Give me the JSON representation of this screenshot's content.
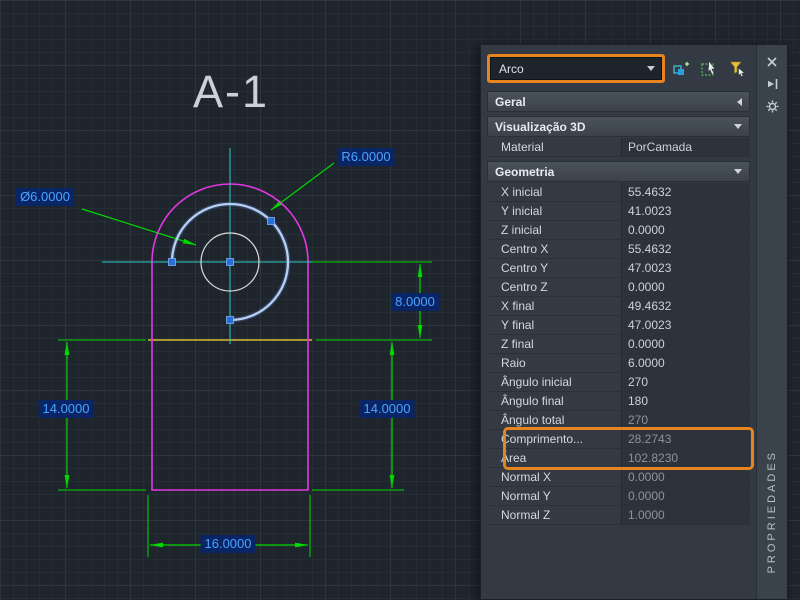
{
  "drawing": {
    "title": "A-1",
    "labels": {
      "diameter": "Ø6.0000",
      "radius": "R6.0000",
      "dim_8": "8.0000",
      "dim_14_left": "14.0000",
      "dim_14_right": "14.0000",
      "dim_16": "16.0000"
    }
  },
  "panel": {
    "object_selector": {
      "value": "Arco"
    },
    "toolbar": {
      "icons": [
        "toggle-value-icon",
        "select-objects-icon",
        "quick-select-icon"
      ]
    },
    "titlebar": {
      "icons": [
        "close-icon",
        "auto-hide-icon",
        "settings-icon"
      ],
      "title": "PROPRIEDADES"
    },
    "sections": {
      "geral": {
        "label": "Geral",
        "collapsed": true
      },
      "vis3d": {
        "label": "Visualização 3D",
        "rows": [
          {
            "label": "Material",
            "value": "PorCamada"
          }
        ]
      },
      "geometria": {
        "label": "Geometria",
        "rows": [
          {
            "label": "X inicial",
            "value": "55.4632"
          },
          {
            "label": "Y inicial",
            "value": "41.0023"
          },
          {
            "label": "Z inicial",
            "value": "0.0000"
          },
          {
            "label": "Centro X",
            "value": "55.4632"
          },
          {
            "label": "Centro Y",
            "value": "47.0023"
          },
          {
            "label": "Centro Z",
            "value": "0.0000"
          },
          {
            "label": "X final",
            "value": "49.4632"
          },
          {
            "label": "Y final",
            "value": "47.0023"
          },
          {
            "label": "Z final",
            "value": "0.0000"
          },
          {
            "label": "Raio",
            "value": "6.0000"
          },
          {
            "label": "Ângulo inicial",
            "value": "270"
          },
          {
            "label": "Ângulo final",
            "value": "180"
          },
          {
            "label": "Ângulo total",
            "value": "270"
          },
          {
            "label": "Comprimento...",
            "value": "28.2743"
          },
          {
            "label": "Área",
            "value": "102.8230"
          },
          {
            "label": "Normal X",
            "value": "0.0000"
          },
          {
            "label": "Normal Y",
            "value": "0.0000"
          },
          {
            "label": "Normal Z",
            "value": "1.0000"
          }
        ]
      }
    }
  },
  "colors": {
    "accent_orange": "#e8831d",
    "dim_text_blue": "#4aa3ff",
    "dim_text_bg": "#0a2566",
    "dimension_green": "#00d800",
    "shape_magenta": "#e238e2",
    "crosshair_cyan": "#2ecaca",
    "shoulder_yellow": "#d2bc2e",
    "selected_arc_blue": "#b8cff5",
    "canvas_bg": "#1f252d",
    "panel_bg": "#333a43"
  }
}
